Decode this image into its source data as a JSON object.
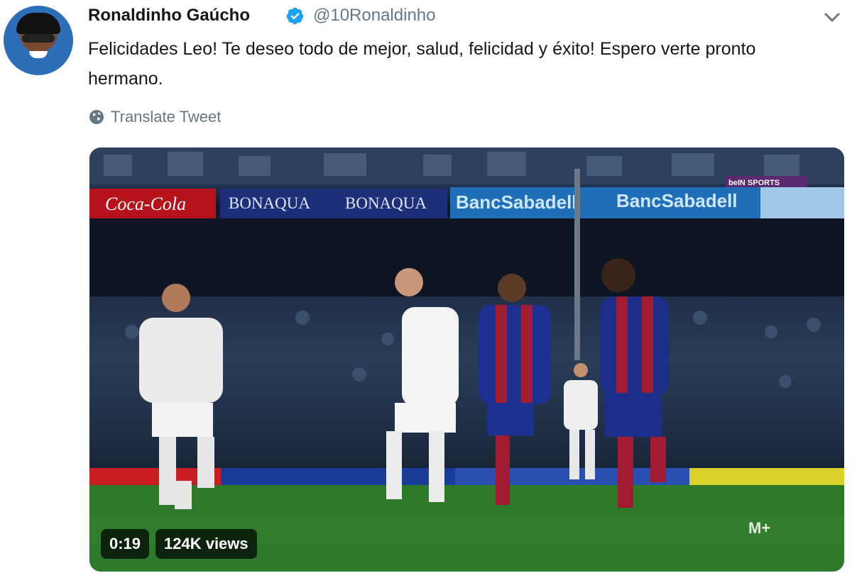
{
  "tweet": {
    "author_name": "Ronaldinho Gaúcho",
    "handle": "@10Ronaldinho",
    "text": "Felicidades Leo! Te deseo todo de mejor, salud, felicidad y éxito! Espero verte pronto hermano.",
    "translate_label": "Translate Tweet"
  },
  "media": {
    "duration": "0:19",
    "views": "124K views",
    "ad_boards": [
      "Coca-Cola",
      "BONAQUA",
      "BONAQUA",
      "BancSabadell",
      "BancSabadell"
    ],
    "broadcaster_logo": "beIN SPORTS",
    "watermark": "M+"
  },
  "colors": {
    "verified_blue": "#1da1f2",
    "secondary_text": "#657786",
    "primary_text": "#14171a"
  },
  "icons": [
    "verified-badge-icon",
    "chevron-down-icon",
    "globe-icon"
  ]
}
